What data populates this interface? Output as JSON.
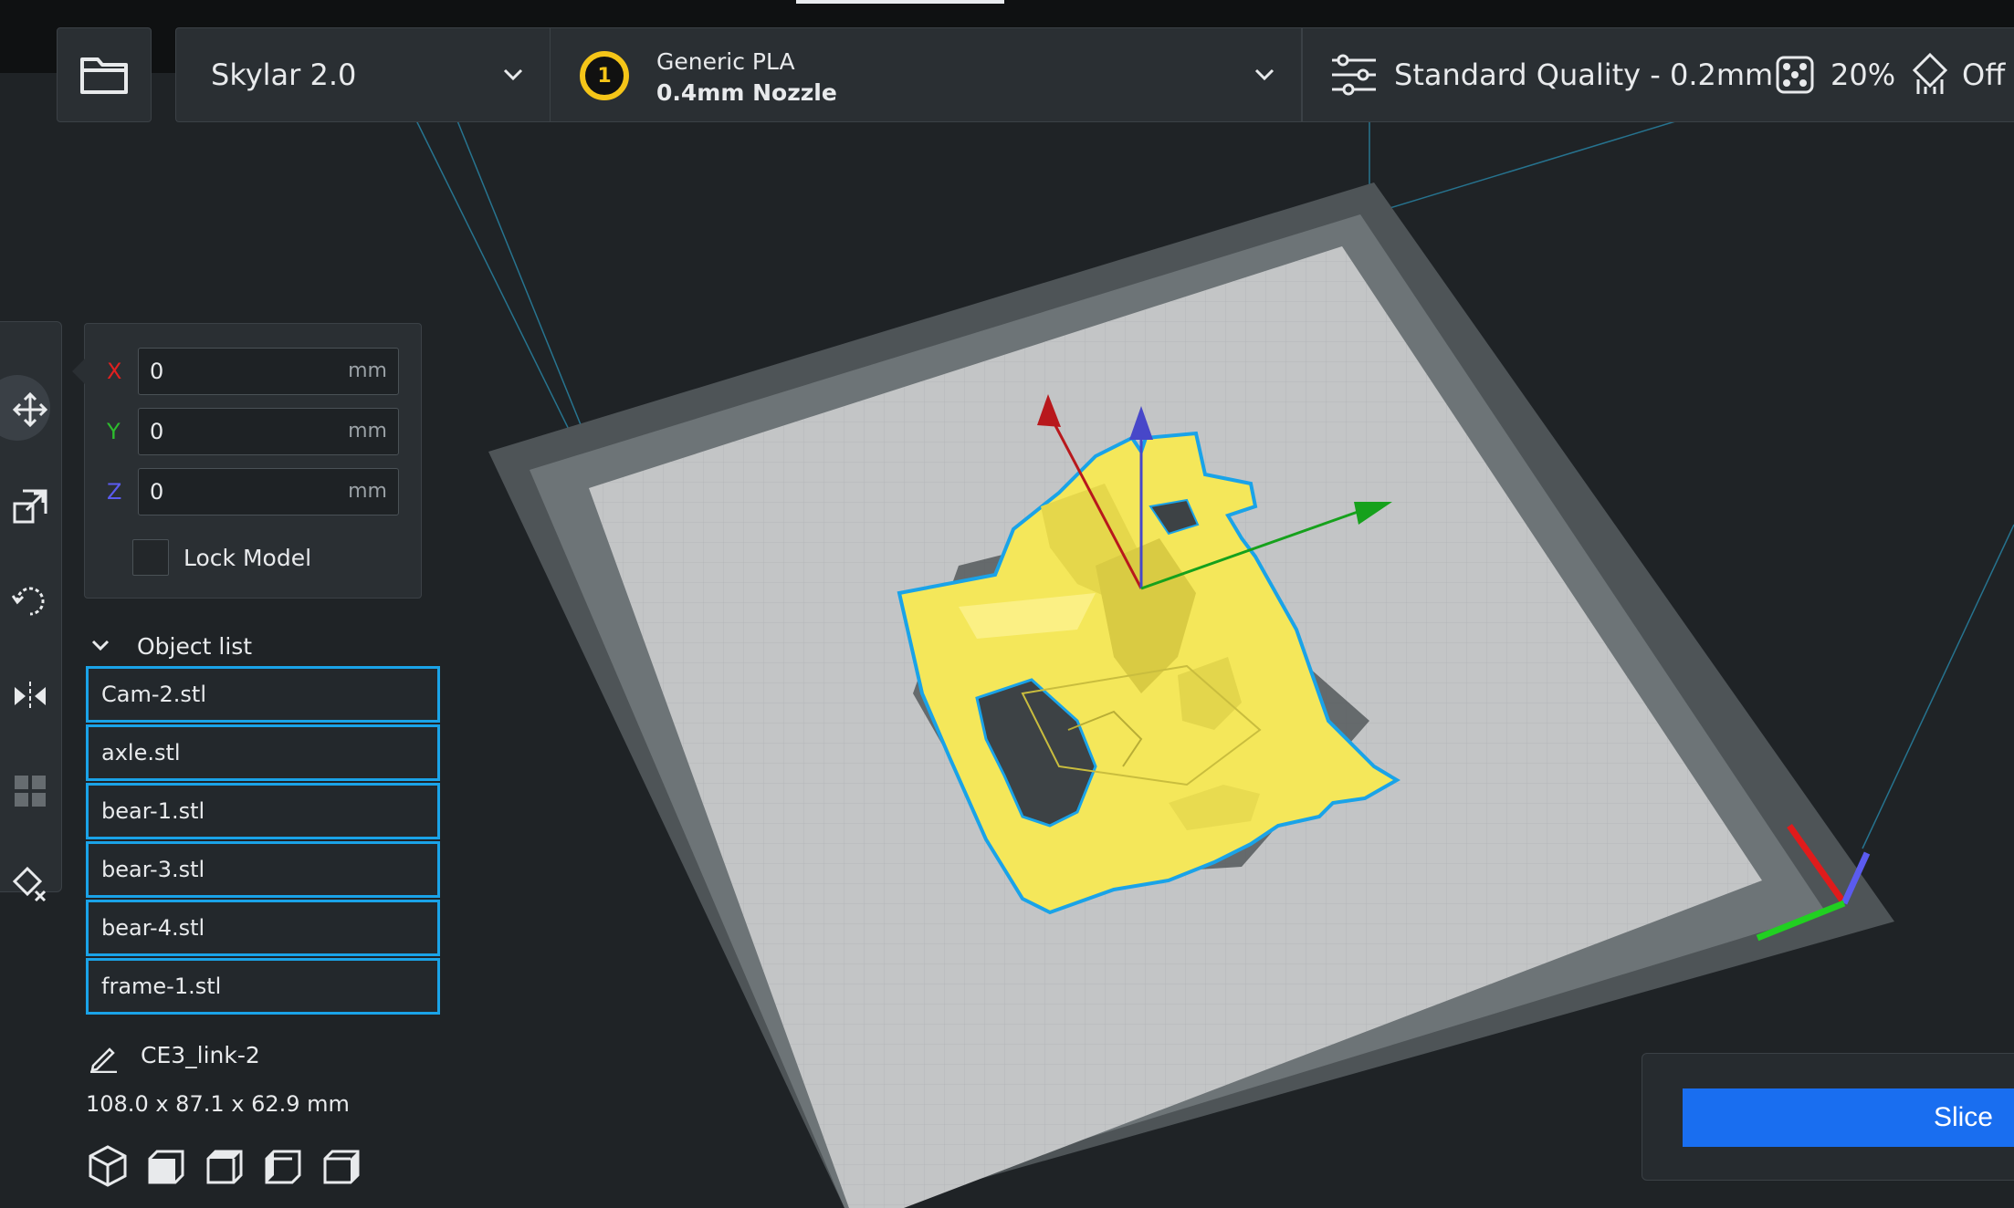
{
  "header": {
    "printer": "Skylar 2.0",
    "material": {
      "extruder_number": "1",
      "name": "Generic PLA",
      "nozzle": "0.4mm Nozzle",
      "badge_color": "#f5c518"
    },
    "quality": "Standard Quality - 0.2mm",
    "infill": "20%",
    "support": "Off"
  },
  "toolbar": {
    "tools": [
      "move-icon",
      "scale-icon",
      "rotate-icon",
      "mirror-icon",
      "per-model-settings-icon",
      "support-blocker-icon"
    ],
    "active_tool": "move"
  },
  "position": {
    "x": {
      "label": "X",
      "value": "0",
      "unit": "mm",
      "color": "#e02020"
    },
    "y": {
      "label": "Y",
      "value": "0",
      "unit": "mm",
      "color": "#2dbd2d"
    },
    "z": {
      "label": "Z",
      "value": "0",
      "unit": "mm",
      "color": "#5b5bf0"
    },
    "lock_label": "Lock Model"
  },
  "object_list": {
    "title": "Object list",
    "items": [
      "Cam-2.stl",
      "axle.stl",
      "bear-1.stl",
      "bear-3.stl",
      "bear-4.stl",
      "frame-1.stl"
    ]
  },
  "project": {
    "name": "CE3_link-2",
    "dimensions": "108.0 x 87.1 x 62.9 mm"
  },
  "view_buttons": [
    "3d-view-icon",
    "front-view-icon",
    "top-view-icon",
    "left-view-icon",
    "right-view-icon"
  ],
  "slice": {
    "label": "Slice",
    "color": "#196ef0"
  },
  "colors": {
    "selection_outline": "#1aa3e8",
    "model": "#f4e75a",
    "background": "#1f2326"
  }
}
